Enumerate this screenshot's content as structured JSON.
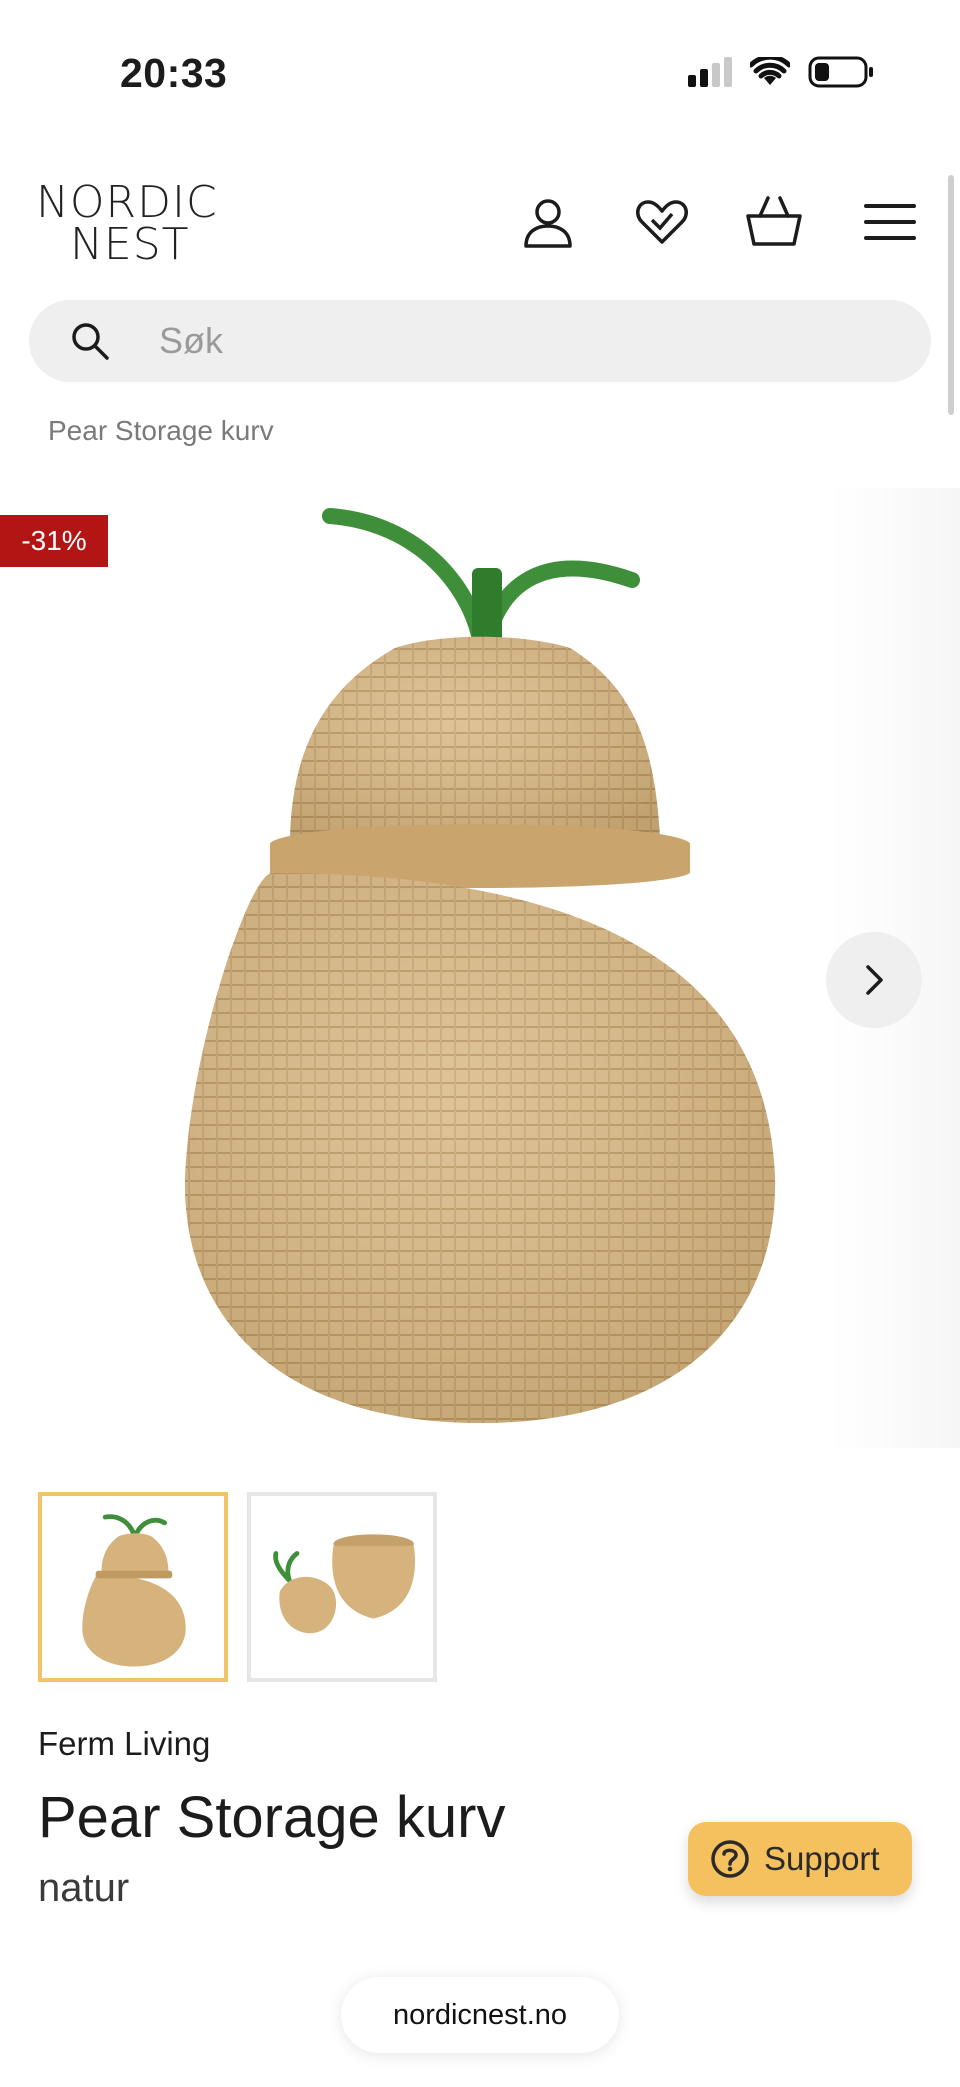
{
  "status_bar": {
    "time": "20:33",
    "battery_level": 0.25,
    "signal_bars": 2,
    "signal_total": 4
  },
  "header": {
    "logo_line1": "NORDIC",
    "logo_line2": "NEST",
    "icons": [
      "user-icon",
      "wishlist-heart-icon",
      "cart-basket-icon",
      "menu-icon"
    ]
  },
  "search": {
    "placeholder": "Søk"
  },
  "breadcrumb": {
    "current": "Pear Storage kurv"
  },
  "product": {
    "discount_badge": "-31%",
    "brand": "Ferm Living",
    "title": "Pear Storage kurv",
    "variant": "natur",
    "thumbnails": [
      {
        "label": "pear-basket-closed",
        "active": true
      },
      {
        "label": "pear-basket-open",
        "active": false
      }
    ]
  },
  "support": {
    "label": "Support"
  },
  "browser": {
    "url": "nordicnest.no"
  },
  "colors": {
    "discount_red": "#b31515",
    "support_yellow": "#f5c15e",
    "thumb_active_border": "#f2c46a",
    "wicker": "#d8b783",
    "leaf_green": "#3f8f3a"
  }
}
